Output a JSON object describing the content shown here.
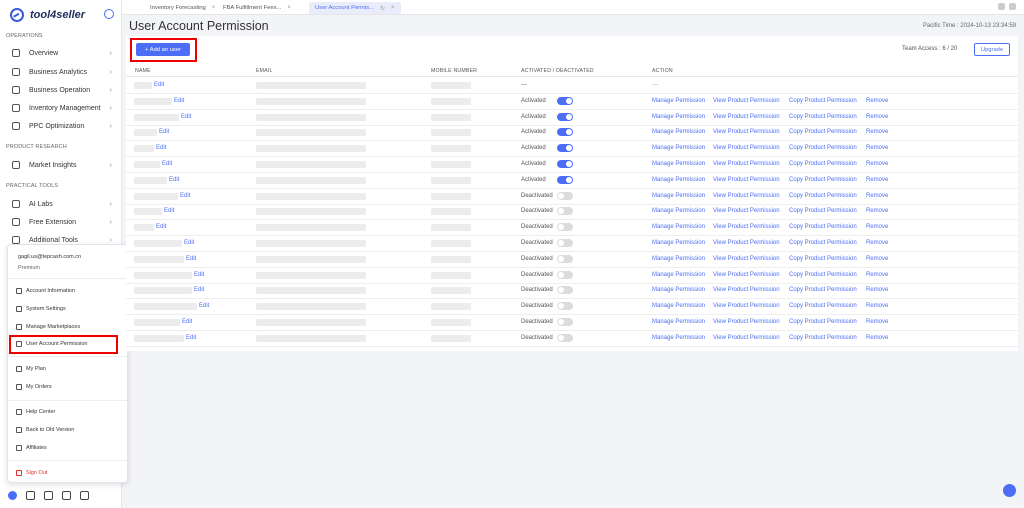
{
  "app": {
    "logo_text": "tool4seller"
  },
  "sidebar": {
    "sections": [
      "OPERATIONS",
      "PRODUCT RESEARCH",
      "PRACTICAL TOOLS"
    ],
    "items": [
      {
        "label": "Overview",
        "icon": "home-icon"
      },
      {
        "label": "Business Analytics",
        "icon": "chart-icon"
      },
      {
        "label": "Business Operation",
        "icon": "briefcase-icon"
      },
      {
        "label": "Inventory Management",
        "icon": "box-icon"
      },
      {
        "label": "PPC Optimization",
        "icon": "monitor-icon"
      },
      {
        "label": "Market Insights",
        "icon": "store-icon"
      },
      {
        "label": "AI Labs",
        "icon": "ai-icon"
      },
      {
        "label": "Free Extension",
        "icon": "puzzle-icon"
      },
      {
        "label": "Additional Tools",
        "icon": "tools-icon"
      }
    ]
  },
  "account_menu": {
    "email": "gagil.us@tepcash.com.cn",
    "plan": "Premium",
    "items": [
      {
        "label": "Account Information",
        "icon": "id-card-icon"
      },
      {
        "label": "System Settings",
        "icon": "gear-icon"
      },
      {
        "label": "Manage Marketplaces",
        "icon": "map-icon"
      },
      {
        "label": "User Account Permission",
        "icon": "users-icon"
      },
      {
        "label": "My Plan",
        "icon": "stack-icon"
      },
      {
        "label": "My Orders",
        "icon": "document-icon"
      },
      {
        "label": "Help Center",
        "icon": "help-icon"
      },
      {
        "label": "Back to Old Version",
        "icon": "back-arrow-icon"
      },
      {
        "label": "Affiliates",
        "icon": "external-link-icon"
      },
      {
        "label": "Sign Out",
        "icon": "logout-icon"
      }
    ]
  },
  "tabs": [
    {
      "label": "Inventory Forecasting",
      "active": false
    },
    {
      "label": "FBA Fulfillment Fees...",
      "active": false
    },
    {
      "label": "User Account Permis...",
      "active": true
    }
  ],
  "page": {
    "title": "User Account Permission",
    "pacific_time": "Pacific Time : 2024-10-13 23:34:59",
    "add_user_label": "+ Add an user",
    "team_access": "Team Access : 6 / 20",
    "upgrade_label": "Upgrade"
  },
  "table": {
    "headers": [
      "NAME",
      "EMAIL",
      "MOBILE NUMBER",
      "ACTIVATED / DEACTIVATED",
      "ACTION"
    ],
    "edit_label": "Edit",
    "actions": [
      "Manage Permission",
      "View Product Permission",
      "Copy Product Permission",
      "Remove"
    ],
    "rows": [
      {
        "status": "---",
        "toggle": null
      },
      {
        "status": "Activated",
        "toggle": true
      },
      {
        "status": "Activated",
        "toggle": true
      },
      {
        "status": "Activated",
        "toggle": true
      },
      {
        "status": "Activated",
        "toggle": true
      },
      {
        "status": "Activated",
        "toggle": true
      },
      {
        "status": "Activated",
        "toggle": true
      },
      {
        "status": "Deactivated",
        "toggle": false
      },
      {
        "status": "Deactivated",
        "toggle": false
      },
      {
        "status": "Deactivated",
        "toggle": false
      },
      {
        "status": "Deactivated",
        "toggle": false
      },
      {
        "status": "Deactivated",
        "toggle": false
      },
      {
        "status": "Deactivated",
        "toggle": false
      },
      {
        "status": "Deactivated",
        "toggle": false
      },
      {
        "status": "Deactivated",
        "toggle": false
      },
      {
        "status": "Deactivated",
        "toggle": false
      },
      {
        "status": "Deactivated",
        "toggle": false
      }
    ]
  },
  "colors": {
    "accent": "#4c6ef5",
    "highlight": "#ee0000"
  }
}
